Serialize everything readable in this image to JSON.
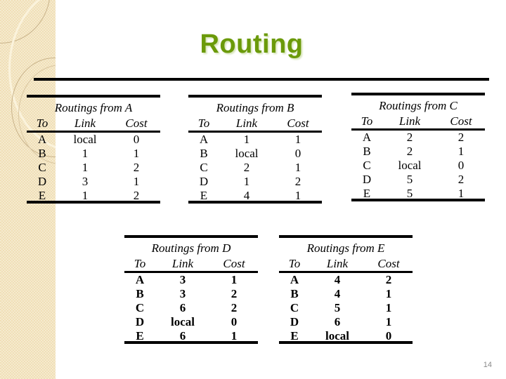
{
  "slide": {
    "title": "Routing",
    "page_number": "14",
    "title_color": "#6b9a0a"
  },
  "columns": {
    "to": "To",
    "link": "Link",
    "cost": "Cost"
  },
  "tables": {
    "a": {
      "caption": "Routings from A",
      "rows": [
        {
          "to": "A",
          "link": "local",
          "cost": "0"
        },
        {
          "to": "B",
          "link": "1",
          "cost": "1"
        },
        {
          "to": "C",
          "link": "1",
          "cost": "2"
        },
        {
          "to": "D",
          "link": "3",
          "cost": "1"
        },
        {
          "to": "E",
          "link": "1",
          "cost": "2"
        }
      ]
    },
    "b": {
      "caption": "Routings from B",
      "rows": [
        {
          "to": "A",
          "link": "1",
          "cost": "1"
        },
        {
          "to": "B",
          "link": "local",
          "cost": "0"
        },
        {
          "to": "C",
          "link": "2",
          "cost": "1"
        },
        {
          "to": "D",
          "link": "1",
          "cost": "2"
        },
        {
          "to": "E",
          "link": "4",
          "cost": "1"
        }
      ]
    },
    "c": {
      "caption": "Routings from C",
      "rows": [
        {
          "to": "A",
          "link": "2",
          "cost": "2"
        },
        {
          "to": "B",
          "link": "2",
          "cost": "1"
        },
        {
          "to": "C",
          "link": "local",
          "cost": "0"
        },
        {
          "to": "D",
          "link": "5",
          "cost": "2"
        },
        {
          "to": "E",
          "link": "5",
          "cost": "1"
        }
      ]
    },
    "d": {
      "caption": "Routings from D",
      "rows": [
        {
          "to": "A",
          "link": "3",
          "cost": "1"
        },
        {
          "to": "B",
          "link": "3",
          "cost": "2"
        },
        {
          "to": "C",
          "link": "6",
          "cost": "2"
        },
        {
          "to": "D",
          "link": "local",
          "cost": "0"
        },
        {
          "to": "E",
          "link": "6",
          "cost": "1"
        }
      ]
    },
    "e": {
      "caption": "Routings from E",
      "rows": [
        {
          "to": "A",
          "link": "4",
          "cost": "2"
        },
        {
          "to": "B",
          "link": "4",
          "cost": "1"
        },
        {
          "to": "C",
          "link": "5",
          "cost": "1"
        },
        {
          "to": "D",
          "link": "6",
          "cost": "1"
        },
        {
          "to": "E",
          "link": "local",
          "cost": "0"
        }
      ]
    }
  }
}
